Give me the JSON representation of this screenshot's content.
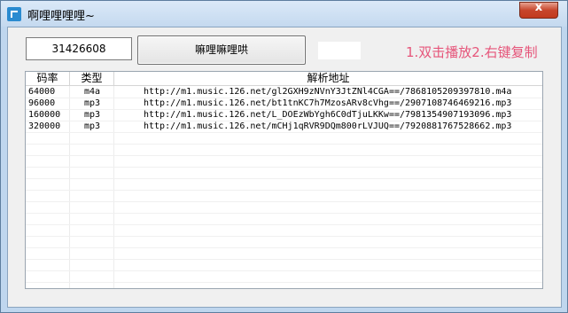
{
  "window": {
    "title": "啊哩哩哩哩~",
    "close_glyph": "x"
  },
  "toolbar": {
    "id_value": "31426608",
    "action_label": "嘛哩嘛哩哄",
    "hint": "1.双击播放2.右键复制"
  },
  "table": {
    "headers": {
      "bitrate": "码率",
      "type": "类型",
      "url": "解析地址"
    },
    "rows": [
      {
        "bitrate": "64000",
        "type": "m4a",
        "url": "http://m1.music.126.net/gl2GXH9zNVnY3JtZNl4CGA==/7868105209397810.m4a"
      },
      {
        "bitrate": "96000",
        "type": "mp3",
        "url": "http://m1.music.126.net/bt1tnKC7h7MzosARv8cVhg==/2907108746469216.mp3"
      },
      {
        "bitrate": "160000",
        "type": "mp3",
        "url": "http://m1.music.126.net/L_DOEzWbYgh6C0dTjuLKKw==/7981354907193096.mp3"
      },
      {
        "bitrate": "320000",
        "type": "mp3",
        "url": "http://m1.music.126.net/mCHj1qRVR9DQm800rLVJUQ==/7920881767528662.mp3"
      }
    ]
  }
}
